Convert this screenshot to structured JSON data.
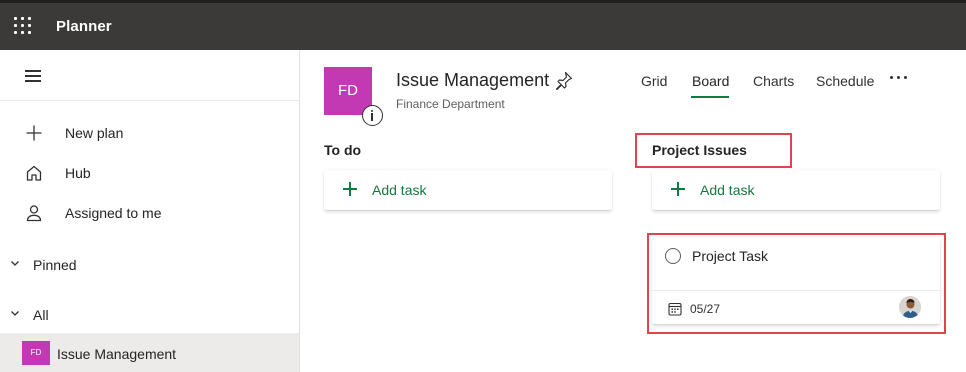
{
  "app": {
    "title": "Planner",
    "waffle_icon": "waffle-icon"
  },
  "sidebar": {
    "menu_icon": "hamburger-icon",
    "nav": [
      {
        "label": "New plan",
        "icon": "plus-icon"
      },
      {
        "label": "Hub",
        "icon": "home-icon"
      },
      {
        "label": "Assigned to me",
        "icon": "person-icon"
      }
    ],
    "sections": [
      {
        "label": "Pinned",
        "icon": "chevron-down-icon"
      },
      {
        "label": "All",
        "icon": "chevron-down-icon"
      }
    ],
    "plans": [
      {
        "initials": "FD",
        "label": "Issue Management",
        "color": "#c239b3"
      }
    ]
  },
  "plan": {
    "initials": "FD",
    "title": "Issue Management",
    "group": "Finance Department",
    "color": "#c239b3",
    "pin_icon": "pin-icon",
    "info_icon": "info-icon"
  },
  "tabs": [
    {
      "label": "Grid",
      "active": false
    },
    {
      "label": "Board",
      "active": true
    },
    {
      "label": "Charts",
      "active": false
    },
    {
      "label": "Schedule",
      "active": false
    }
  ],
  "more_icon": "more-icon",
  "buckets": [
    {
      "name": "To do",
      "add_task_label": "Add task",
      "tasks": []
    },
    {
      "name": "Project Issues",
      "add_task_label": "Add task",
      "tasks": [
        {
          "title": "Project Task",
          "due": "05/27",
          "assignee_icon": "avatar"
        }
      ]
    }
  ],
  "colors": {
    "topbar": "#3b3a39",
    "accent": "#107c41",
    "highlight": "#e2444e",
    "plan": "#c239b3",
    "selected_nav": "#edebe9"
  }
}
